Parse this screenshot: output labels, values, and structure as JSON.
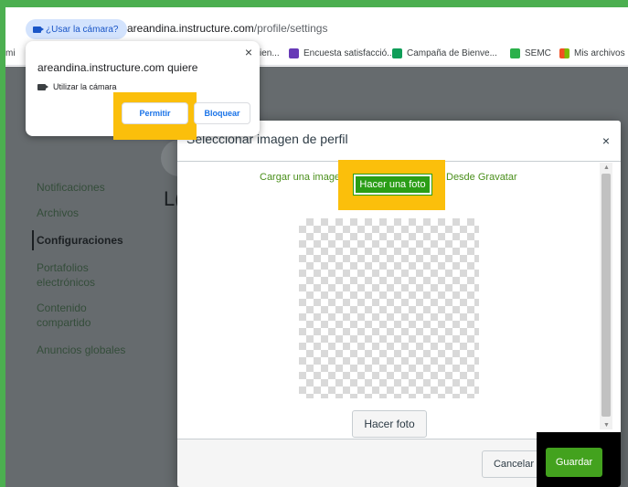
{
  "browser": {
    "camera_chip": "¿Usar la cámara?",
    "url_domain": "areandina.instructure.com",
    "url_path": "/profile/settings"
  },
  "bookmarks": [
    {
      "label": "mi",
      "color": "#ffffff"
    },
    {
      "label": "ien...",
      "color": "#ffffff"
    },
    {
      "label": "Encuesta satisfacció...",
      "color": "#673ab7"
    },
    {
      "label": "Campaña de Bienve...",
      "color": "#0f9d58"
    },
    {
      "label": "SEMC",
      "color": "#2ab04a"
    },
    {
      "label": "Mis archivos",
      "color": "#f25022"
    }
  ],
  "permission": {
    "title": "areandina.instructure.com quiere",
    "camera_label": "Utilizar la cámara",
    "allow_label": "Permitir",
    "deny_label": "Bloquear"
  },
  "sidebar": {
    "items": [
      {
        "label": "Notificaciones"
      },
      {
        "label": "Archivos"
      },
      {
        "label": "Configuraciones"
      },
      {
        "label": "Portafolios electrónicos"
      },
      {
        "label": "Contenido compartido"
      },
      {
        "label": "Anuncios globales"
      }
    ]
  },
  "page": {
    "heading_fragment": "L("
  },
  "modal": {
    "title": "Seleccionar imagen de perfil",
    "close": "×",
    "tabs": [
      {
        "label": "Cargar una imagen"
      },
      {
        "label": "Hacer una foto"
      },
      {
        "label": "Desde Gravatar"
      }
    ],
    "snap_label": "Hacer foto",
    "cancel_label": "Cancelar",
    "save_label": "Guardar"
  },
  "colors": {
    "accent_green": "#43a21e",
    "highlight_yellow": "#fbbf0b"
  }
}
